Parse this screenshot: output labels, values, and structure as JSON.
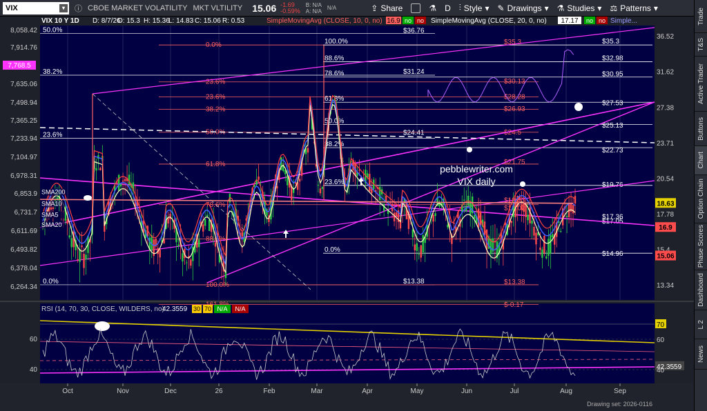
{
  "toolbar": {
    "symbol": "VIX",
    "name": "CBOE MARKET VOLATILITY",
    "short_name": "MKT VLTILITY",
    "price": "15.06",
    "change": "-1.69",
    "change_pct": "-0.59%",
    "bid": "B: N/A",
    "ask": "A: N/A",
    "bid_sub": "N/A",
    "ask_sub": "",
    "share": "Share",
    "d_label": "D",
    "style": "Style",
    "drawings": "Drawings",
    "studies": "Studies",
    "patterns": "Patterns"
  },
  "sidebar": [
    "Trade",
    "T&S",
    "Active Trader",
    "Buttons",
    "Chart",
    "Option Chain",
    "Phase Scores",
    "Dashboard",
    "L 2",
    "News"
  ],
  "sidebar_active": 4,
  "colors": {
    "bg": "#000042",
    "price_up": "#2ecc40",
    "price_down": "#ff4b4b",
    "magenta": "#ff33ff",
    "fib_red": "#ff6060",
    "white": "#ffffff",
    "yellow": "#e6d200",
    "blue": "#4060ff",
    "pink_rsi": "#dd55ff"
  },
  "header": {
    "symbol_tf": "VIX 10 Y 1D",
    "d": "D: 8/7/26",
    "o": "O: 15.3",
    "h": "H: 15.36",
    "l": "L: 14.83",
    "c": "C: 15.06",
    "r": "R: 0.53",
    "sma1": "SimpleMovingAvg (CLOSE, 10, 0, no)",
    "sma1_val": "16.9",
    "no": "no",
    "sma2": "SimpleMovingAvg (CLOSE, 20, 0, no)",
    "sma2_val": "17.17",
    "sma_more": "Simple..."
  },
  "rsi_header": {
    "label": "RSI (14, 70, 30, CLOSE, WILDERS, no)",
    "value": "42.3559",
    "v30": "30",
    "v70": "70",
    "na1": "N/A",
    "na2": "N/A"
  },
  "watermark": {
    "line1": "pebblewriter.com",
    "line2": "VIX daily"
  },
  "footer": "Drawing set: 2026-0116",
  "chart_data": {
    "type": "candlestick",
    "x_ticks": [
      "Oct",
      "Nov",
      "Dec",
      "26",
      "Feb",
      "Mar",
      "Apr",
      "May",
      "Jun",
      "Jul",
      "Aug",
      "Sep"
    ],
    "left_axis": [
      "8,058.42",
      "7,914.76",
      "7,768.5",
      "7,635.06",
      "7,498.94",
      "7,365.25",
      "7,233.94",
      "7,104.97",
      "6,978.31",
      "6,853.9",
      "6,731.7",
      "6,611.69",
      "6,493.82",
      "6,378.04",
      "6,264.34"
    ],
    "left_axis_marker": "7,768.5",
    "right_axis": [
      "36.52",
      "31.62",
      "27.38",
      "23.71",
      "20.54",
      "17.78",
      "15.4",
      "13.34"
    ],
    "right_markers": [
      {
        "label": "18.63",
        "value": 18.63,
        "color": "#e6d200"
      },
      {
        "label": "16.9",
        "value": 16.9,
        "color": "#ff4b4b"
      },
      {
        "label": "15.06",
        "value": 15.06,
        "color": "#ff4b4b"
      }
    ],
    "fib_right_labels": [
      {
        "label": "$35.3",
        "value": 35.3
      },
      {
        "label": "$32.98",
        "value": 32.98
      },
      {
        "label": "$30.95",
        "value": 30.95
      },
      {
        "label": "$27.53",
        "value": 27.53
      },
      {
        "label": "$25.13",
        "value": 25.13
      },
      {
        "label": "$22.73",
        "value": 22.73
      },
      {
        "label": "$19.76",
        "value": 19.76
      },
      {
        "label": "$17.36",
        "value": 17.36
      },
      {
        "label": "$17.05",
        "value": 17.05
      },
      {
        "label": "$14.96",
        "value": 14.96
      }
    ],
    "fib_red_labels": [
      {
        "label": "$35.3",
        "value": 35.3
      },
      {
        "label": "$30.13",
        "value": 30.13
      },
      {
        "label": "$28.28",
        "value": 28.28
      },
      {
        "label": "$26.93",
        "value": 26.93
      },
      {
        "label": "$24.5",
        "value": 24.5
      },
      {
        "label": "$21.75",
        "value": 21.75
      },
      {
        "label": "$18.63",
        "value": 18.63
      },
      {
        "label": "$18.02",
        "value": 18.02
      },
      {
        "label": "$13.38",
        "value": 13.38
      },
      {
        "label": "$-0.17",
        "value": 12.2
      }
    ],
    "fib_mid_labels": [
      {
        "label": "$36.76",
        "value": 36.9
      },
      {
        "label": "$31.24",
        "value": 31.24
      },
      {
        "label": "$24.41",
        "value": 24.41
      },
      {
        "label": "$13.38",
        "value": 13.38
      }
    ],
    "fib_levels_left": [
      {
        "label": "50.0%",
        "value": 37.0
      },
      {
        "label": "38.2%",
        "value": 31.24
      },
      {
        "label": "23.6%",
        "value": 24.2
      },
      {
        "label": "0.0%",
        "value": 13.38
      }
    ],
    "fib_levels_mid_red": [
      {
        "label": "0.0%",
        "value": 35.3
      },
      {
        "label": "23.6%",
        "value": 30.4
      },
      {
        "label": "23.6%",
        "value": 28.6
      },
      {
        "label": "38.2%",
        "value": 27.2
      },
      {
        "label": "50.0%",
        "value": 24.8
      },
      {
        "label": "61.8%",
        "value": 21.8
      },
      {
        "label": "78.6%",
        "value": 18.5
      },
      {
        "label": "88.6%",
        "value": 16.1
      },
      {
        "label": "100.0%",
        "value": 13.38
      },
      {
        "label": "161.8%",
        "value": 12.35
      }
    ],
    "fib_levels_mid_white": [
      {
        "label": "100.0%",
        "value": 35.3
      },
      {
        "label": "88.6%",
        "value": 32.98
      },
      {
        "label": "78.6%",
        "value": 31.0
      },
      {
        "label": "61.8%",
        "value": 28.0
      },
      {
        "label": "50.0%",
        "value": 25.6
      },
      {
        "label": "38.2%",
        "value": 23.3
      },
      {
        "label": "23.6%",
        "value": 20.0
      },
      {
        "label": "0.0%",
        "value": 15.2
      }
    ],
    "sma_labels": [
      "SMA200",
      "SMA10",
      "SMA5",
      "SMA20"
    ],
    "ohlc": [],
    "y_range": [
      12.0,
      38.0
    ],
    "rsi_axis": [
      "60",
      "40"
    ],
    "rsi_right": [
      "70",
      "60",
      "42.3559",
      "40"
    ],
    "rsi_range": [
      28,
      78
    ]
  }
}
